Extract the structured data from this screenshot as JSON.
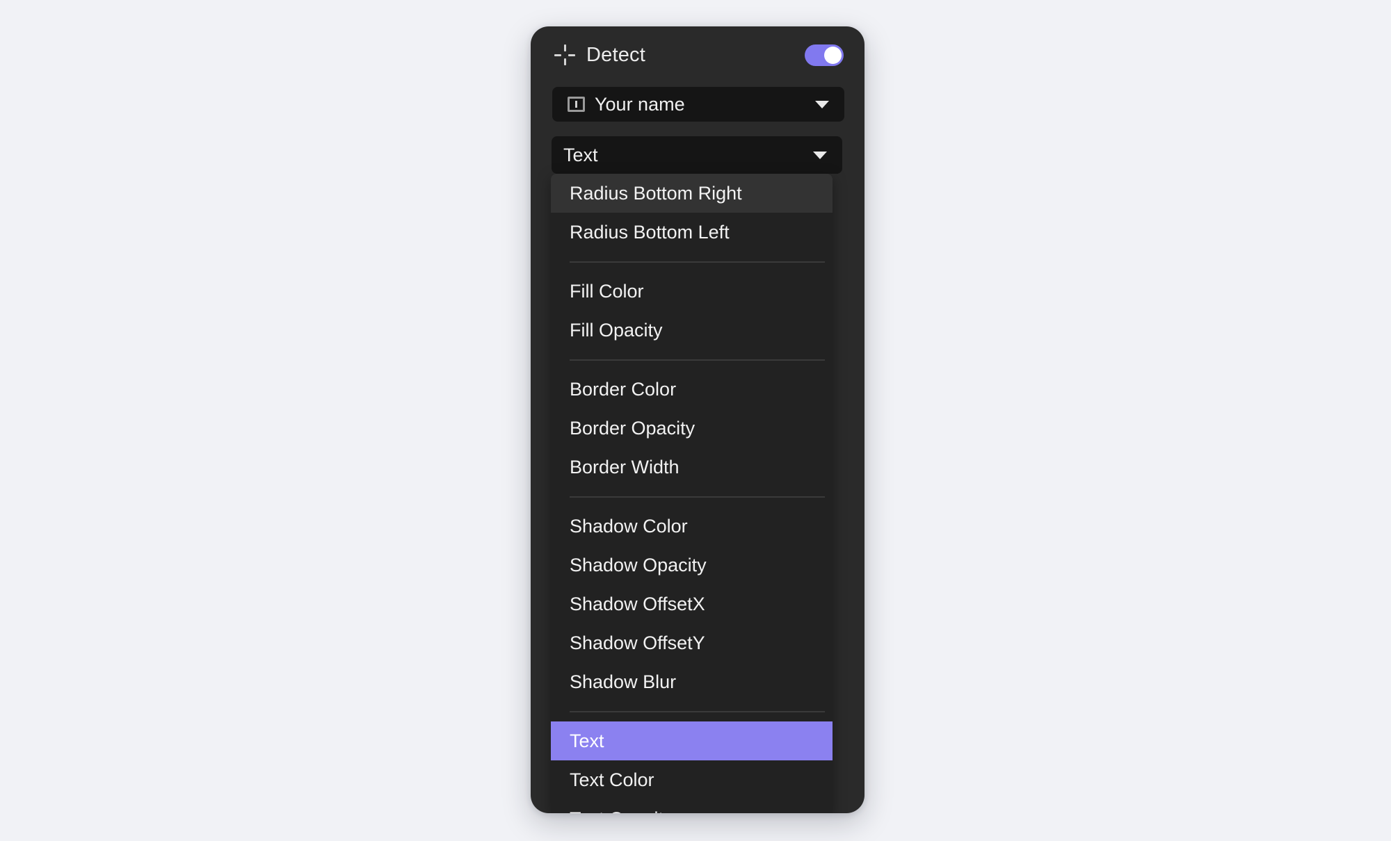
{
  "background_color": "#f1f2f6",
  "panel": {
    "background_color": "#2a2a2a",
    "header": {
      "icon": "detect-crosshair-icon",
      "title": "Detect",
      "toggle": {
        "state": "on",
        "accent_color": "#8179ef"
      }
    },
    "element_select": {
      "icon": "input-field-icon",
      "value": "Your name",
      "caret": "chevron-down-icon"
    },
    "property_select": {
      "value": "Text",
      "caret": "chevron-down-icon"
    },
    "dropdown": {
      "highlight_color": "#8b81f0",
      "hover_color": "#333333",
      "hovered_item": "Radius Bottom Right",
      "selected_item": "Text",
      "groups": [
        {
          "items": [
            {
              "label": "Radius Bottom Right",
              "state": "hovered"
            },
            {
              "label": "Radius Bottom Left",
              "state": "normal"
            }
          ]
        },
        {
          "items": [
            {
              "label": "Fill Color",
              "state": "normal"
            },
            {
              "label": "Fill Opacity",
              "state": "normal"
            }
          ]
        },
        {
          "items": [
            {
              "label": "Border Color",
              "state": "normal"
            },
            {
              "label": "Border Opacity",
              "state": "normal"
            },
            {
              "label": "Border Width",
              "state": "normal"
            }
          ]
        },
        {
          "items": [
            {
              "label": "Shadow Color",
              "state": "normal"
            },
            {
              "label": "Shadow Opacity",
              "state": "normal"
            },
            {
              "label": "Shadow OffsetX",
              "state": "normal"
            },
            {
              "label": "Shadow OffsetY",
              "state": "normal"
            },
            {
              "label": "Shadow Blur",
              "state": "normal"
            }
          ]
        },
        {
          "items": [
            {
              "label": "Text",
              "state": "selected"
            },
            {
              "label": "Text Color",
              "state": "normal"
            },
            {
              "label": "Text Opacity",
              "state": "normal"
            }
          ]
        }
      ]
    }
  }
}
